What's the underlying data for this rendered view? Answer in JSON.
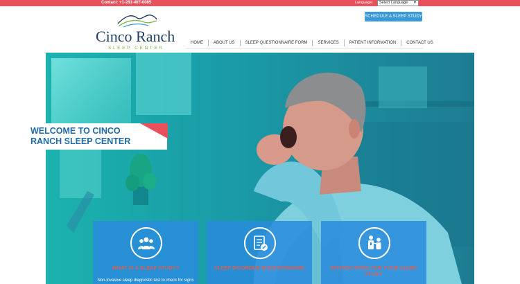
{
  "topbar": {
    "contact": "Contact: +1-281-407-0085",
    "language_label": "Language:",
    "language_select": "Select Language"
  },
  "header": {
    "schedule_button": "SCHEDULE A SLEEP STUDY",
    "logo_name": "Cinco Ranch",
    "logo_sub": "SLEEP CENTER"
  },
  "nav": {
    "items": [
      "HOME",
      "ABOUT US",
      "SLEEP QUESTIONNAIRE FORM",
      "SERVICES",
      "PATIENT INFORMATION",
      "CONTACT US"
    ]
  },
  "hero": {
    "welcome": "WELCOME TO CINCO RANCH SLEEP CENTER"
  },
  "cards": [
    {
      "title": "WHAT IS A SLEEP STUDY?",
      "description": "Non-invasive sleep diagnostic test to check for signs",
      "icon": "group-icon"
    },
    {
      "title": "SLEEP DISORDER QUESTIONNAIRE",
      "description": "",
      "icon": "form-icon"
    },
    {
      "title": "INSTRUCTIONS FOR YOUR SLEEP STUDY",
      "description": "",
      "icon": "doctor-patient-icon"
    }
  ],
  "colors": {
    "accent_red": "#e8505b",
    "brand_blue": "#1f3d66",
    "brand_green": "#7fb842",
    "button_blue": "#3a9ad9",
    "hero_teal": "#1bb2ae"
  }
}
